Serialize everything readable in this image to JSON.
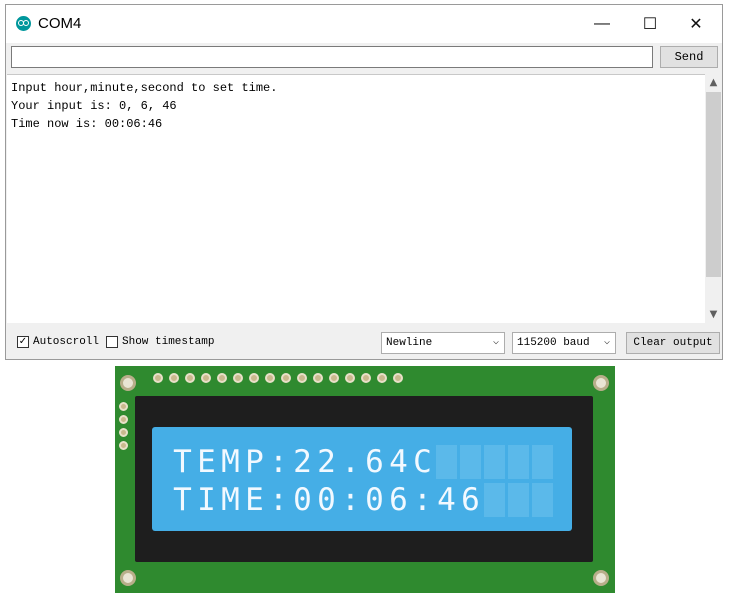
{
  "window": {
    "title": "COM4",
    "minimize_glyph": "—",
    "maximize_glyph": "☐",
    "close_glyph": "✕"
  },
  "toolbar": {
    "send_label": "Send",
    "input_value": ""
  },
  "output_lines": [
    "Input hour,minute,second to set time.",
    "Your input is: 0, 6, 46",
    "Time now is: 00:06:46"
  ],
  "footer": {
    "autoscroll_label": "Autoscroll",
    "autoscroll_checked": "✓",
    "timestamp_label": "Show timestamp",
    "line_ending": "Newline",
    "baud": "115200 baud",
    "clear_label": "Clear output"
  },
  "lcd": {
    "line1": "TEMP:22.64C",
    "line2": "TIME:00:06:46",
    "columns": 16
  },
  "colors": {
    "board": "#2f8a2f",
    "lcd_background": "#45aee6",
    "app_icon": "#00979c"
  }
}
